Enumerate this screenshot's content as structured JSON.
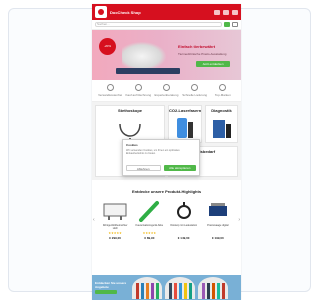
{
  "site": {
    "brand": "DocCheck Shop",
    "search_placeholder": "Suchen..."
  },
  "hero": {
    "badge": "-20%",
    "title": "Einfach tierbewährt",
    "subtitle": "Tiermedizinische Praxis-Ausstattung",
    "cta": "Jetzt entdecken"
  },
  "usps": [
    {
      "label": "Versandkostenfrei",
      "icon": "truck-icon"
    },
    {
      "label": "Kauf auf Rechnung",
      "icon": "invoice-icon"
    },
    {
      "label": "Expertenberatung",
      "icon": "user-icon"
    },
    {
      "label": "Schnelle Lieferung",
      "icon": "clock-icon"
    },
    {
      "label": "Top-Marken",
      "icon": "star-icon"
    }
  ],
  "categories": [
    {
      "label": "Stethoskope"
    },
    {
      "label": "CO2-Laserfasern"
    },
    {
      "label": "Diagnostik"
    },
    {
      "label": "Praxisbedarf"
    }
  ],
  "cookie": {
    "title": "Cookies",
    "text": "Wir verwenden Cookies, um Ihnen ein optimales Einkaufserlebnis zu bieten.",
    "reject": "Ablehnen",
    "accept": "Alle akzeptieren"
  },
  "products_section": {
    "title": "Entdecke unsere Produkt-Highlights",
    "items": [
      {
        "name": "Röntgenbildbetrachter LED",
        "stars": "★★★★★",
        "price": "€ 299,00"
      },
      {
        "name": "Kauterisationsgerät Akku",
        "stars": "★★★★★",
        "price": "€ 89,90"
      },
      {
        "name": "Otoskop mit Ladestation",
        "stars": "",
        "price": "€ 149,00"
      },
      {
        "name": "Praxiswaage digital",
        "stars": "",
        "price": "€ 199,00"
      }
    ]
  },
  "promo": {
    "text": "Entdecken Sie unsere Angebote"
  }
}
